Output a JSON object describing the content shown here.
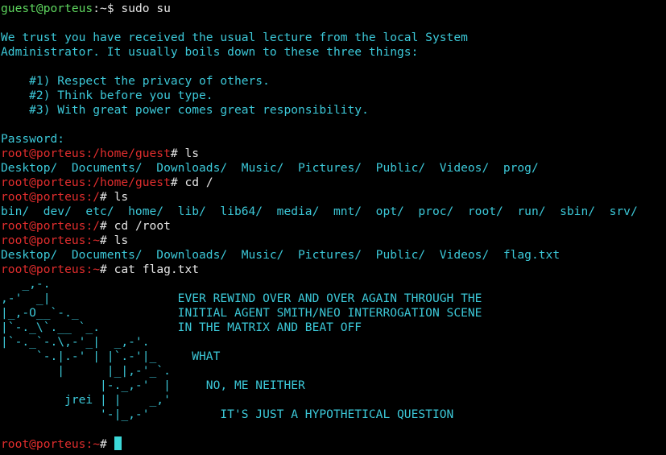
{
  "colors": {
    "background": "#000000",
    "text": "#3cc8d8",
    "user_prompt": "#5fd75f",
    "root_prompt": "#e02d2d",
    "command": "#e6e6e6",
    "cursor": "#3cd8d8"
  },
  "lines": [
    {
      "type": "prompt",
      "user": "guest@porteus",
      "sep": ":",
      "path": "~",
      "symbol": "$ ",
      "cmd": "sudo su"
    },
    {
      "type": "text",
      "text": ""
    },
    {
      "type": "text",
      "text": "We trust you have received the usual lecture from the local System"
    },
    {
      "type": "text",
      "text": "Administrator. It usually boils down to these three things:"
    },
    {
      "type": "text",
      "text": ""
    },
    {
      "type": "text",
      "text": "    #1) Respect the privacy of others."
    },
    {
      "type": "text",
      "text": "    #2) Think before you type."
    },
    {
      "type": "text",
      "text": "    #3) With great power comes great responsibility."
    },
    {
      "type": "text",
      "text": ""
    },
    {
      "type": "text",
      "text": "Password:"
    },
    {
      "type": "rootprompt",
      "user": "root@porteus",
      "sep": ":",
      "path": "/home/guest",
      "symbol": "# ",
      "cmd": "ls"
    },
    {
      "type": "text",
      "text": "Desktop/  Documents/  Downloads/  Music/  Pictures/  Public/  Videos/  prog/"
    },
    {
      "type": "rootprompt",
      "user": "root@porteus",
      "sep": ":",
      "path": "/home/guest",
      "symbol": "# ",
      "cmd": "cd /"
    },
    {
      "type": "rootprompt",
      "user": "root@porteus",
      "sep": ":",
      "path": "/",
      "symbol": "# ",
      "cmd": "ls"
    },
    {
      "type": "text",
      "text": "bin/  dev/  etc/  home/  lib/  lib64/  media/  mnt/  opt/  proc/  root/  run/  sbin/  srv/"
    },
    {
      "type": "rootprompt",
      "user": "root@porteus",
      "sep": ":",
      "path": "/",
      "symbol": "# ",
      "cmd": "cd /root"
    },
    {
      "type": "rootprompt",
      "user": "root@porteus",
      "sep": ":",
      "path": "~",
      "symbol": "# ",
      "cmd": "ls"
    },
    {
      "type": "text",
      "text": "Desktop/  Documents/  Downloads/  Music/  Pictures/  Public/  Videos/  flag.txt"
    },
    {
      "type": "rootprompt",
      "user": "root@porteus",
      "sep": ":",
      "path": "~",
      "symbol": "# ",
      "cmd": "cat flag.txt"
    },
    {
      "type": "art",
      "text": "   _,-."
    },
    {
      "type": "art",
      "text": ",-'  _|                  EVER REWIND OVER AND OVER AGAIN THROUGH THE"
    },
    {
      "type": "art",
      "text": "|_,-O__`-._              INITIAL AGENT SMITH/NEO INTERROGATION SCENE"
    },
    {
      "type": "art",
      "text": "|`-._\\`.__ `_.           IN THE MATRIX AND BEAT OFF"
    },
    {
      "type": "art",
      "text": "|`-._`-.\\,-'_|  _,-'."
    },
    {
      "type": "art",
      "text": "     `-.|.-' | |`.-'|_     WHAT"
    },
    {
      "type": "art",
      "text": "        |      |_|,-'_`."
    },
    {
      "type": "art",
      "text": "              |-._,-'  |     NO, ME NEITHER"
    },
    {
      "type": "art",
      "text": "         jrei | |    _,'"
    },
    {
      "type": "art",
      "text": "              '-|_,-'          IT'S JUST A HYPOTHETICAL QUESTION"
    },
    {
      "type": "text",
      "text": ""
    },
    {
      "type": "rootprompt",
      "user": "root@porteus",
      "sep": ":",
      "path": "~",
      "symbol": "# ",
      "cmd": "",
      "cursor": true
    }
  ]
}
